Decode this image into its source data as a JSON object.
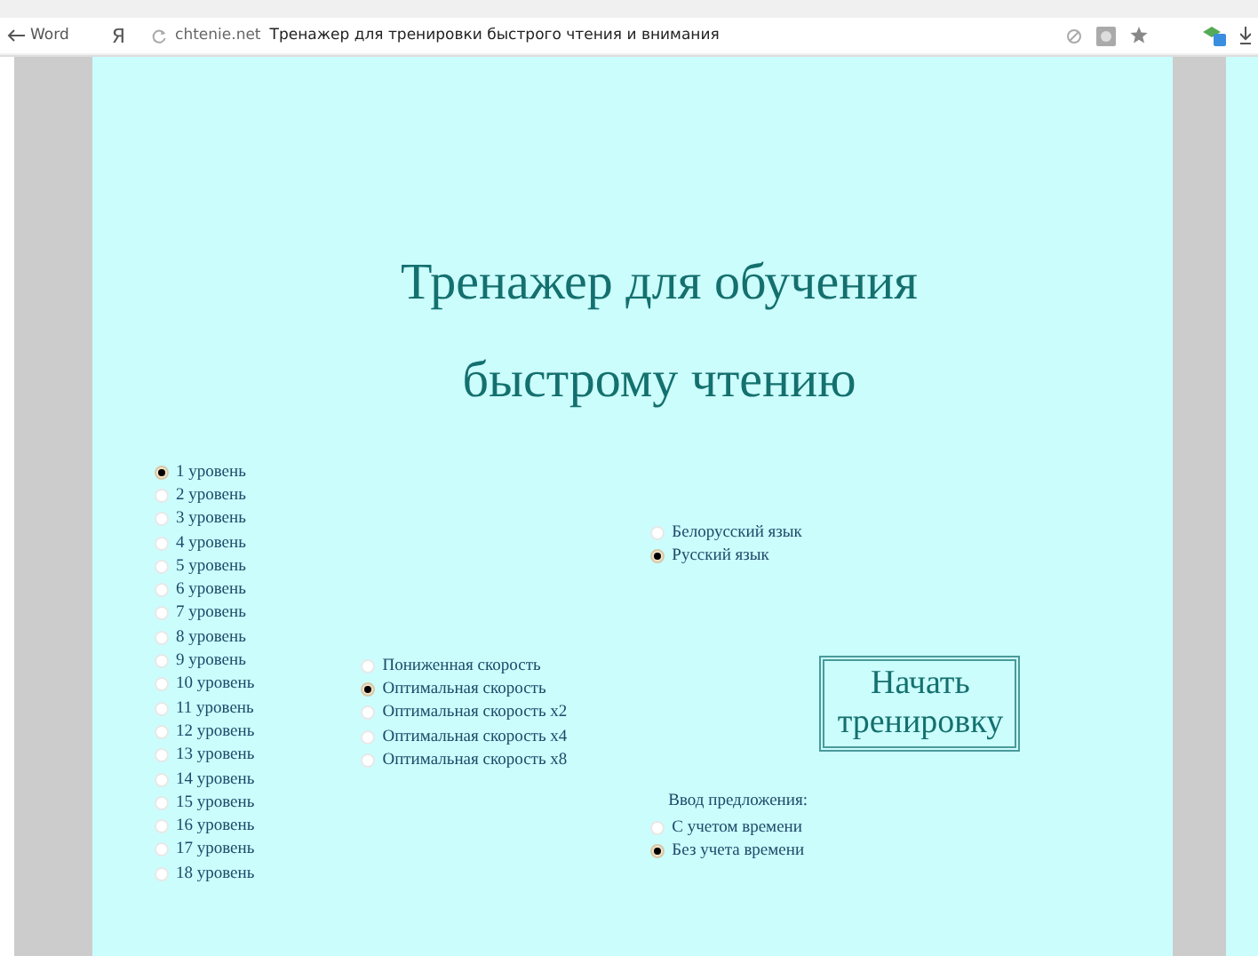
{
  "browser": {
    "back_label": "Word",
    "home_label": "Я",
    "domain": "chtenie.net",
    "page_title": "Тренажер для тренировки быстрого чтения и внимания"
  },
  "title_lines": [
    "Тренажер для обучения",
    "быстрому чтению"
  ],
  "levels": [
    {
      "label": "1 уровень",
      "selected": true
    },
    {
      "label": "2 уровень",
      "selected": false
    },
    {
      "label": "3 уровень",
      "selected": false
    },
    {
      "label": "4 уровень",
      "selected": false
    },
    {
      "label": "5 уровень",
      "selected": false
    },
    {
      "label": "6 уровень",
      "selected": false
    },
    {
      "label": "7 уровень",
      "selected": false
    },
    {
      "label": "8 уровень",
      "selected": false
    },
    {
      "label": "9 уровень",
      "selected": false
    },
    {
      "label": "10 уровень",
      "selected": false
    },
    {
      "label": "11 уровень",
      "selected": false
    },
    {
      "label": "12 уровень",
      "selected": false
    },
    {
      "label": "13 уровень",
      "selected": false
    },
    {
      "label": "14 уровень",
      "selected": false
    },
    {
      "label": "15 уровень",
      "selected": false
    },
    {
      "label": "16 уровень",
      "selected": false
    },
    {
      "label": "17 уровень",
      "selected": false
    },
    {
      "label": "18 уровень",
      "selected": false
    }
  ],
  "speeds": [
    {
      "label": "Пониженная скорость",
      "selected": false
    },
    {
      "label": "Оптимальная скорость",
      "selected": true
    },
    {
      "label": "Оптимальная скорость x2",
      "selected": false
    },
    {
      "label": "Оптимальная скорость x4",
      "selected": false
    },
    {
      "label": "Оптимальная скорость x8",
      "selected": false
    }
  ],
  "languages": [
    {
      "label": "Белорусский язык",
      "selected": false
    },
    {
      "label": "Русский язык",
      "selected": true
    }
  ],
  "start_button": {
    "label_lines": [
      "Начать",
      "тренировку"
    ]
  },
  "sentence_input": {
    "heading": "Ввод предложения:",
    "options": [
      {
        "label": "С учетом времени",
        "selected": false
      },
      {
        "label": "Без учета времени",
        "selected": true
      }
    ]
  }
}
